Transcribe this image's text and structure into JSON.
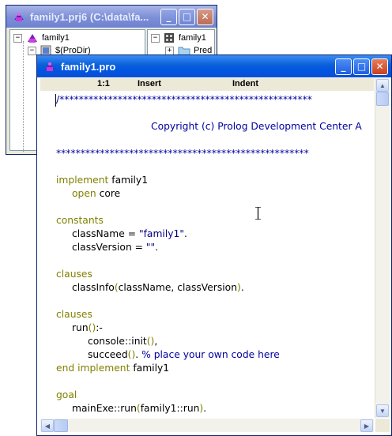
{
  "project_window": {
    "title": "family1.prj6 (C:\\data\\fa...",
    "buttons": {
      "minimize": "_",
      "maximize": "□",
      "close": "✕"
    },
    "left_tree": [
      {
        "label": "family1",
        "expander": "−",
        "icon": "project-icon"
      },
      {
        "label": "$(ProDir)",
        "expander": "−",
        "icon": "package-icon"
      }
    ],
    "right_tree": [
      {
        "label": "family1",
        "expander": "−",
        "icon": "package-icon"
      },
      {
        "label": "Pred",
        "expander": "+",
        "icon": "folder-icon"
      }
    ]
  },
  "editor_window": {
    "title": "family1.pro",
    "buttons": {
      "minimize": "_",
      "maximize": "□",
      "close": "✕"
    },
    "status": {
      "position": "1:1",
      "mode": "Insert",
      "indent": "Indent"
    },
    "code": {
      "stars_open": "/****************************************************",
      "copyright": "Copyright (c) Prolog Development Center A",
      "stars_close": "****************************************************",
      "l_implement_kw": "implement",
      "l_implement_name": " family1",
      "l_open_kw": "open",
      "l_open_name": " core",
      "l_constants": "constants",
      "l_classname_a": "className = ",
      "l_classname_str": "\"family1\"",
      "l_classname_b": ".",
      "l_classversion_a": "classVersion = ",
      "l_classversion_str": "\"\"",
      "l_classversion_b": ".",
      "l_clauses1": "clauses",
      "l_classinfo_a": "classInfo",
      "l_classinfo_p1": "(",
      "l_classinfo_b": "className, classVersion",
      "l_classinfo_p2": ")",
      "l_classinfo_c": ".",
      "l_clauses2": "clauses",
      "l_run_a": "run",
      "l_run_p": "()",
      "l_run_b": ":-",
      "l_console_a": "console::init",
      "l_console_p": "()",
      "l_console_b": ",",
      "l_succeed_a": "succeed",
      "l_succeed_p": "()",
      "l_succeed_b": ". ",
      "l_succeed_comment": "% place your own code here",
      "l_end_kw": "end implement",
      "l_end_name": " family1",
      "l_goal": "goal",
      "l_main_a": "mainExe::run",
      "l_main_p1": "(",
      "l_main_b": "family1::run",
      "l_main_p2": ")",
      "l_main_c": "."
    },
    "colors": {
      "keyword": "#808000",
      "string": "#000080",
      "comment": "#0000a0",
      "text": "#000000"
    }
  }
}
